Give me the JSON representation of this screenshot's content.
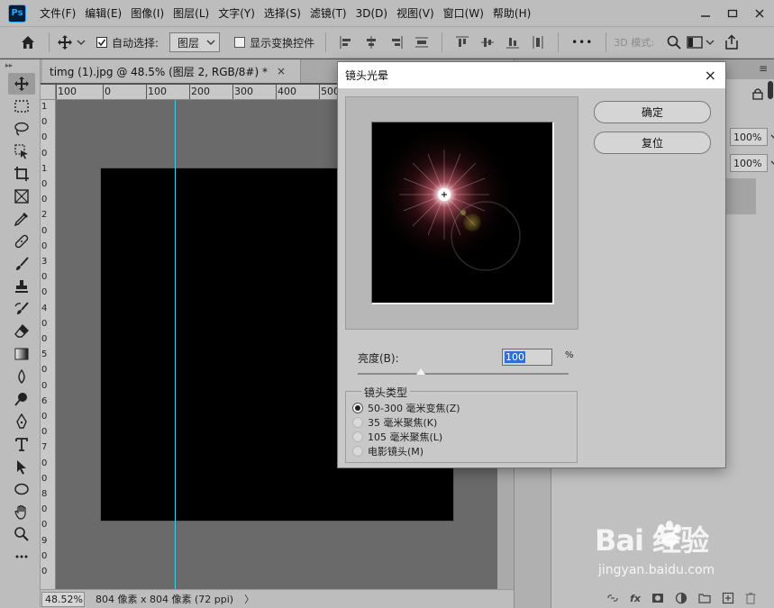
{
  "app": {
    "logo_text": "Ps",
    "menus": [
      "文件(F)",
      "编辑(E)",
      "图像(I)",
      "图层(L)",
      "文字(Y)",
      "选择(S)",
      "滤镜(T)",
      "3D(D)",
      "视图(V)",
      "窗口(W)",
      "帮助(H)"
    ]
  },
  "options": {
    "auto_select_label": "自动选择:",
    "auto_select_checked": true,
    "layer_mode": "图层",
    "show_transform_label": "显示变换控件",
    "show_transform_checked": false,
    "more": "•••",
    "mode_3d_label": "3D 模式:"
  },
  "document": {
    "tab_title": "timg (1).jpg @ 48.5% (图层 2, RGB/8#) *",
    "close": "×",
    "zoom": "48.52%",
    "size_info": "804 像素 x 804 像素 (72 ppi)",
    "status_arrow": "〉"
  },
  "ruler": {
    "top_labels": [
      "100",
      "0",
      "100",
      "200",
      "300",
      "400",
      "500"
    ],
    "left_labels": [
      "1",
      "0",
      "0",
      "0",
      "1",
      "0",
      "0",
      "2",
      "0",
      "0",
      "3",
      "0",
      "0",
      "4",
      "0",
      "0",
      "5",
      "0",
      "0",
      "6",
      "0",
      "0",
      "7",
      "0",
      "0",
      "8",
      "0",
      "0",
      "9",
      "0",
      "0"
    ]
  },
  "layers_panel": {
    "opacity": "100%",
    "fill": "100%",
    "footer_icons": [
      "link-icon",
      "fx-icon",
      "mask-icon",
      "adjustment-icon",
      "folder-icon",
      "new-layer-icon",
      "trash-icon"
    ],
    "fx_label": "fx"
  },
  "dialog": {
    "title": "镜头光晕",
    "close": "×",
    "ok_label": "确定",
    "reset_label": "复位",
    "brightness_label": "亮度(B):",
    "brightness_value": "100",
    "brightness_unit": "%",
    "brightness_slider_fraction": 0.3,
    "lens_type_label": "镜头类型",
    "lens_types": [
      "50-300 毫米变焦(Z)",
      "35 毫米聚焦(K)",
      "105 毫米聚焦(L)",
      "电影镜头(M)"
    ],
    "selected_lens_index": 0
  },
  "watermark": {
    "brand": "Bai  经验",
    "url": "jingyan.baidu.com"
  },
  "colors": {
    "guide": "#37d1e6",
    "accent": "#2f6fd0"
  }
}
